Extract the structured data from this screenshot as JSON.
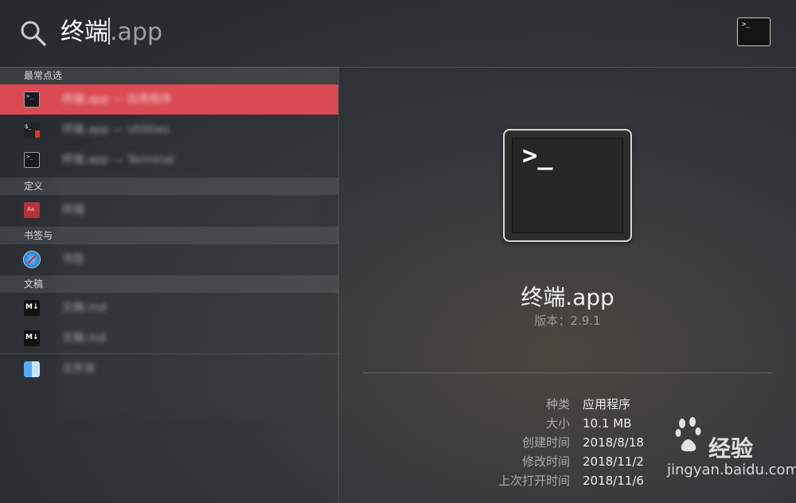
{
  "search": {
    "typed": "终端",
    "completion": ".app"
  },
  "sections": [
    {
      "label": "最常点选"
    },
    {
      "label": "定义"
    },
    {
      "label": "书签与"
    },
    {
      "label": "文稿"
    }
  ],
  "results": [
    {
      "icon": "terminal-icon",
      "text": "终端.app — 应用程序",
      "selected": true
    },
    {
      "icon": "iterm-icon",
      "text": "终端.app — Utilities",
      "selected": false
    },
    {
      "icon": "terminal-icon",
      "text": "终端.app — Terminal",
      "selected": false
    },
    {
      "icon": "dictionary-icon",
      "text": "终端",
      "selected": false
    },
    {
      "icon": "safari-icon",
      "text": "书签",
      "selected": false
    },
    {
      "icon": "markdown-icon",
      "text": "文稿.md",
      "selected": false
    },
    {
      "icon": "markdown-icon",
      "text": "文稿.md",
      "selected": false
    },
    {
      "icon": "finder-icon",
      "text": "文件夹",
      "selected": false
    }
  ],
  "preview": {
    "prompt_glyph": ">_",
    "app_name": "终端.app",
    "version": "版本：2.9.1",
    "info": [
      {
        "label": "种类",
        "value": "应用程序"
      },
      {
        "label": "大小",
        "value": "10.1 MB"
      },
      {
        "label": "创建时间",
        "value": "2018/8/18"
      },
      {
        "label": "修改时间",
        "value": "2018/11/2"
      },
      {
        "label": "上次打开时间",
        "value": "2018/11/6"
      }
    ]
  },
  "header_icon": {
    "glyph": ">_"
  },
  "watermark": {
    "logo": "Bai du",
    "brand": "经验",
    "url": "jingyan.baidu.com"
  },
  "colors": {
    "selection": "#d94a52",
    "background": "#2b2f34"
  }
}
